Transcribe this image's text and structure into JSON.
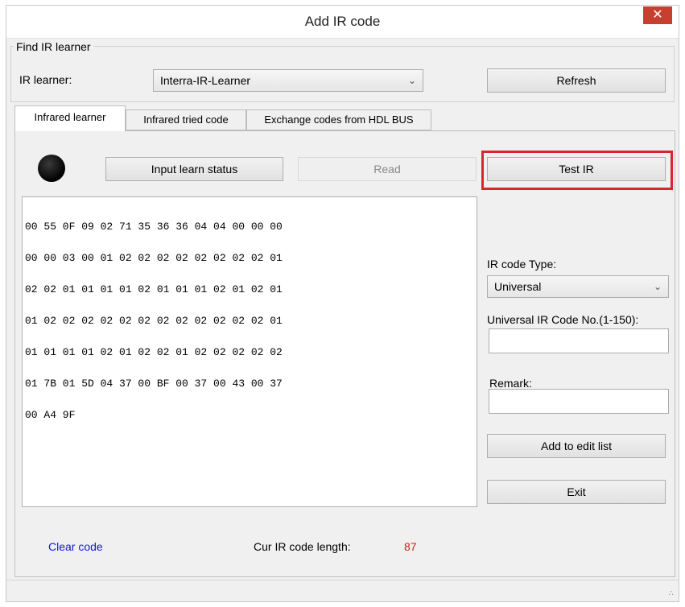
{
  "window": {
    "title": "Add IR code",
    "close_glyph": "✕"
  },
  "find_group": {
    "legend": "Find IR learner",
    "learner_label": "IR learner:",
    "learner_value": "Interra-IR-Learner",
    "refresh_label": "Refresh"
  },
  "tabs": [
    {
      "label": "Infrared learner",
      "active": true
    },
    {
      "label": "Infrared tried code",
      "active": false
    },
    {
      "label": "Exchange codes from HDL BUS",
      "active": false
    }
  ],
  "learner": {
    "input_learn_label": "Input learn status",
    "read_label": "Read",
    "test_label": "Test IR",
    "hex_lines": [
      "00 55 0F 09 02 71 35 36 36 04 04 00 00 00",
      "00 00 03 00 01 02 02 02 02 02 02 02 02 01",
      "02 02 01 01 01 01 02 01 01 01 02 01 02 01",
      "01 02 02 02 02 02 02 02 02 02 02 02 02 01",
      "01 01 01 01 02 01 02 02 01 02 02 02 02 02",
      "01 7B 01 5D 04 37 00 BF 00 37 00 43 00 37",
      "00 A4 9F"
    ],
    "ir_type_label": "IR code Type:",
    "ir_type_value": "Universal",
    "universal_no_label": "Universal IR Code No.(1-150):",
    "universal_no_value": "",
    "remark_label": "Remark:",
    "remark_value": "",
    "add_label": "Add to edit list",
    "exit_label": "Exit",
    "clear_label": "Clear code",
    "length_label": "Cur IR code length:",
    "length_value": "87"
  },
  "colors": {
    "link": "#1515d6",
    "length_value": "#e01818",
    "highlight": "#d9252f",
    "close_bg": "#c7402f"
  },
  "icons": {
    "close": "close-icon",
    "dropdown": "chevron-down-icon",
    "led": "status-led",
    "grip": "resize-grip-icon"
  }
}
